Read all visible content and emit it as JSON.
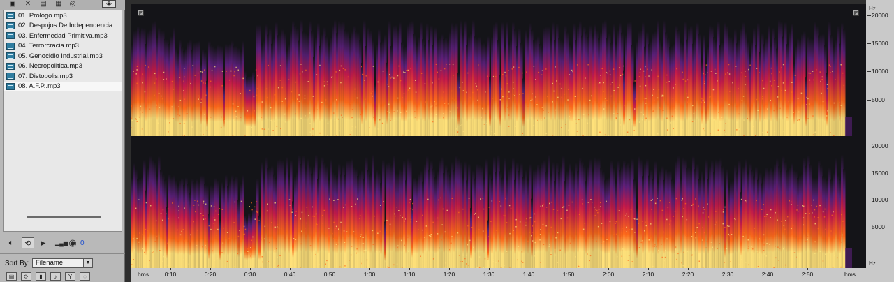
{
  "toolbar": {
    "icons": [
      "open-file-icon",
      "close-file-icon",
      "insert-multitrack-icon",
      "edit-file-icon",
      "autoplay-icon",
      "view-icon"
    ]
  },
  "files": [
    {
      "name": "01. Prologo.mp3",
      "selected": false
    },
    {
      "name": "02. Despojos De Independencia.",
      "selected": false
    },
    {
      "name": "03. Enfermedad Primitiva.mp3",
      "selected": false
    },
    {
      "name": "04. Terrorcracia.mp3",
      "selected": false
    },
    {
      "name": "05. Genocidio Industrial.mp3",
      "selected": false
    },
    {
      "name": "06. Necropolitica.mp3",
      "selected": false
    },
    {
      "name": "07. Distopolis.mp3",
      "selected": false
    },
    {
      "name": "08. A.F.P..mp3",
      "selected": true
    }
  ],
  "transport": {
    "volume_value": "0"
  },
  "sort": {
    "label": "Sort By:",
    "value": "Filename"
  },
  "spectral": {
    "freq_unit": "Hz",
    "freq_labels": [
      "20000",
      "15000",
      "10000",
      "5000"
    ],
    "time_unit": "hms",
    "time_labels": [
      "0:10",
      "0:20",
      "0:30",
      "0:40",
      "0:50",
      "1:00",
      "1:10",
      "1:20",
      "1:30",
      "1:40",
      "1:50",
      "2:00",
      "2:10",
      "2:20",
      "2:30",
      "2:40",
      "2:50"
    ],
    "colors": {
      "low": "#ffe17a",
      "mid": "#ff6a1a",
      "high": "#c41a4a",
      "top": "#5a1f7a",
      "bg": "#141418"
    }
  }
}
